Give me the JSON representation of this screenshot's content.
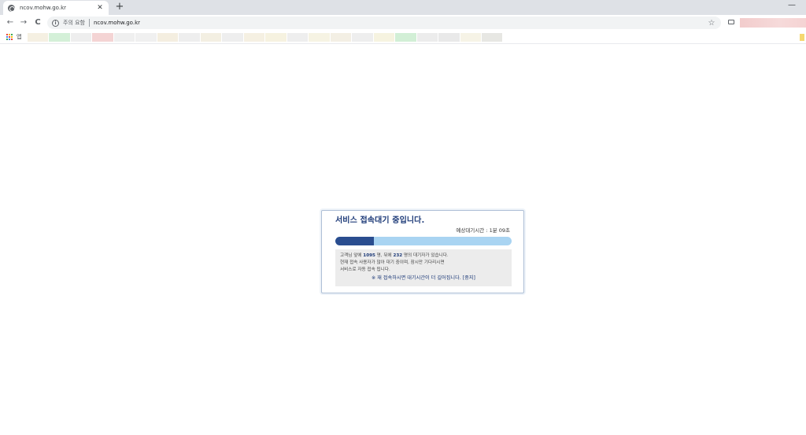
{
  "browser": {
    "tab": {
      "title": "ncov.mohw.go.kr",
      "close": "✕"
    },
    "new_tab": "+",
    "minimize": "—",
    "nav": {
      "back": "←",
      "forward": "→",
      "reload": "C"
    },
    "omnibox": {
      "info": "i",
      "security_label": "주의 요함",
      "url": "ncov.mohw.go.kr",
      "star": "☆"
    },
    "bookmarks": {
      "apps_label": "앱"
    }
  },
  "queue": {
    "title": "서비스 접속대기 중입니다.",
    "eta_label": "예상대기시간 : ",
    "eta_value": "1분 09초",
    "progress_fraction": 0.22,
    "line1_prefix": "고객님 앞에 ",
    "ahead_count": "1095",
    "line1_mid": " 명, 뒤에 ",
    "behind_count": "232",
    "line1_suffix": " 명의 대기자가 있습니다.",
    "line2": "현재 접속 사용자가 많아 대기 중이며, 잠시만 기다리시면",
    "line3": "서비스로 자동 접속 됩니다.",
    "warning": "※ 재 접속하시면 대기시간이 더 길어집니다.",
    "stop_label": "[중지]"
  },
  "colors": {
    "title": "#1d3a78",
    "progress_fill": "#2a4d8f",
    "progress_track": "#a9d4f2",
    "panel_bg": "#ececec"
  }
}
